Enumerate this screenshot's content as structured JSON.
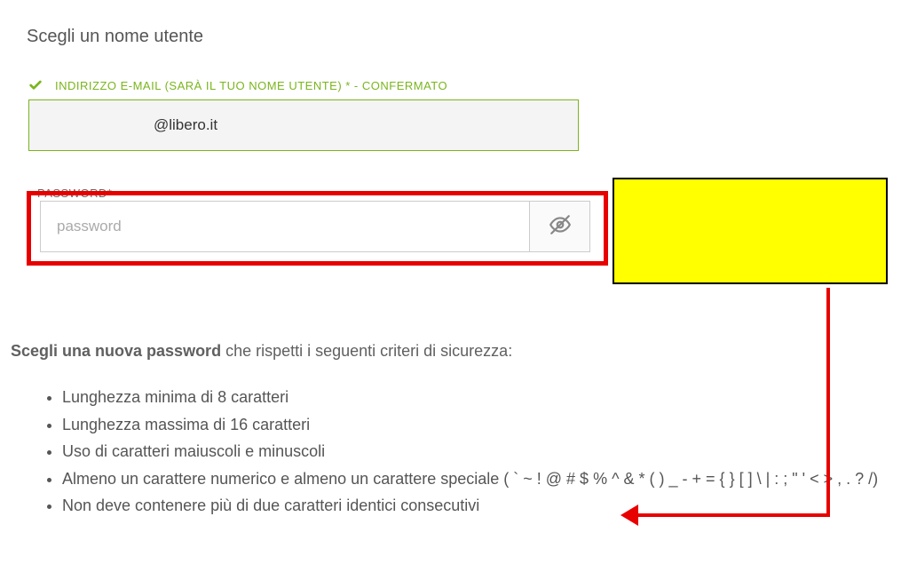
{
  "section_title": "Scegli un nome utente",
  "email": {
    "label": "INDIRIZZO E-MAIL (SARÀ IL TUO NOME UTENTE) * - CONFERMATO",
    "value_suffix": "@libero.it"
  },
  "password": {
    "label": "PASSWORD*",
    "placeholder": "password"
  },
  "criteria": {
    "intro_bold": "Scegli una nuova password",
    "intro_rest": " che rispetti i seguenti criteri di sicurezza:",
    "items": [
      "Lunghezza minima di 8 caratteri",
      "Lunghezza massima di 16 caratteri",
      "Uso di caratteri maiuscoli e minuscoli",
      "Almeno un carattere numerico e almeno un carattere speciale ( ` ~ ! @ # $ % ^ & * ( ) _ - + = { } [ ] \\ | : ; \" ' < > , . ? /)",
      "Non deve contenere più di due caratteri identici consecutivi"
    ]
  }
}
